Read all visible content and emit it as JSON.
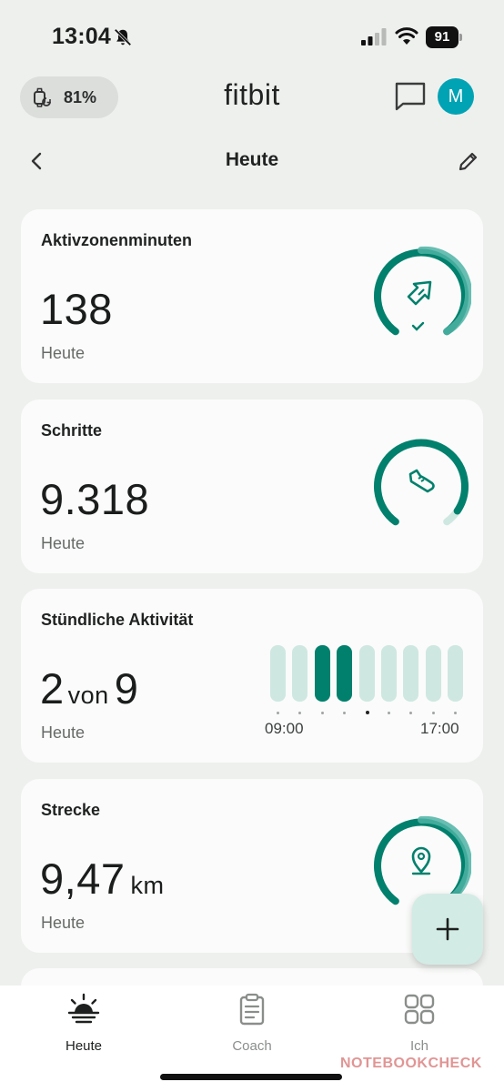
{
  "status_bar": {
    "time": "13:04",
    "battery": "91"
  },
  "header": {
    "device_battery": "81%",
    "brand": "fitbit",
    "avatar_initial": "M"
  },
  "subheader": {
    "title": "Heute"
  },
  "cards": [
    {
      "title": "Aktivzonenminuten",
      "value": "138",
      "unit": "",
      "sub": "Heute",
      "icon": "zone-arrow-icon",
      "goal_fraction": 1.0
    },
    {
      "title": "Schritte",
      "value": "9.318",
      "unit": "",
      "sub": "Heute",
      "icon": "shoe-icon",
      "goal_fraction": 0.93
    },
    {
      "title": "Stündliche Aktivität",
      "value_a": "2",
      "value_mid": "von",
      "value_b": "9",
      "sub": "Heute",
      "hours_active": [
        false,
        false,
        true,
        true,
        false,
        false,
        false,
        false,
        false
      ],
      "current_hour_index": 4,
      "start_label": "09:00",
      "end_label": "17:00"
    },
    {
      "title": "Strecke",
      "value": "9,47",
      "unit": "km",
      "sub": "Heute",
      "icon": "map-pin-icon",
      "goal_fraction": 1.0
    }
  ],
  "nav": [
    {
      "label": "Heute",
      "icon": "sunrise-icon",
      "active": true
    },
    {
      "label": "Coach",
      "icon": "clipboard-icon",
      "active": false
    },
    {
      "label": "Ich",
      "icon": "grid-icon",
      "active": false
    }
  ],
  "colors": {
    "accent": "#00806d",
    "ring_light": "#4eb3a4",
    "ring_pale": "#cfe7e1",
    "background": "#eef0ee"
  },
  "watermark": "NOTEBOOKCHECK"
}
